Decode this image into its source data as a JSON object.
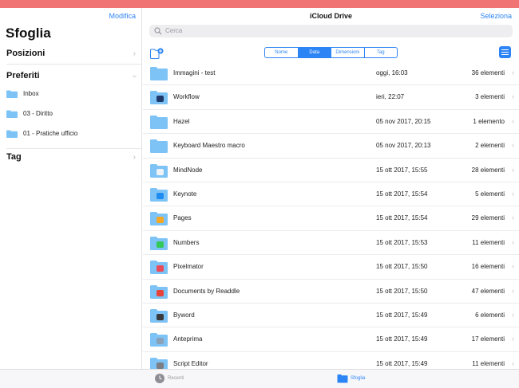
{
  "sidebar": {
    "edit_label": "Modifica",
    "title": "Sfoglia",
    "sections": {
      "locations": "Posizioni",
      "favorites": "Preferiti",
      "tags": "Tag"
    },
    "favorites": [
      {
        "label": "Inbox",
        "icon": "folder-icon"
      },
      {
        "label": "03 - Diritto",
        "icon": "folder-icon"
      },
      {
        "label": "01 - Pratiche ufficio",
        "icon": "folder-icon"
      }
    ]
  },
  "header": {
    "title": "iCloud Drive",
    "select_label": "Seleziona",
    "search_placeholder": "Cerca"
  },
  "sort": {
    "options": [
      "Nome",
      "Data",
      "Dimensioni",
      "Tag"
    ],
    "active": "Data"
  },
  "files": [
    {
      "name": "Immagini - test",
      "date": "oggi, 16:03",
      "count": "36 elementi",
      "badge": ""
    },
    {
      "name": "Workflow",
      "date": "ieri, 22:07",
      "count": "3 elementi",
      "badge": "#1f3a6a"
    },
    {
      "name": "Hazel",
      "date": "05 nov 2017, 20:15",
      "count": "1 elemento",
      "badge": ""
    },
    {
      "name": "Keyboard Maestro macro",
      "date": "05 nov 2017, 20:13",
      "count": "2 elementi",
      "badge": ""
    },
    {
      "name": "MindNode",
      "date": "15 ott 2017, 15:55",
      "count": "28 elementi",
      "badge": "#eef3f7"
    },
    {
      "name": "Keynote",
      "date": "15 ott 2017, 15:54",
      "count": "5 elementi",
      "badge": "#1e8bf0"
    },
    {
      "name": "Pages",
      "date": "15 ott 2017, 15:54",
      "count": "29 elementi",
      "badge": "#f5a623"
    },
    {
      "name": "Numbers",
      "date": "15 ott 2017, 15:53",
      "count": "11 elementi",
      "badge": "#34c759"
    },
    {
      "name": "Pixelmator",
      "date": "15 ott 2017, 15:50",
      "count": "16 elementi",
      "badge": "#e94b5a"
    },
    {
      "name": "Documents by Readdle",
      "date": "15 ott 2017, 15:50",
      "count": "47 elementi",
      "badge": "#e8433a"
    },
    {
      "name": "Byword",
      "date": "15 ott 2017, 15:49",
      "count": "6 elementi",
      "badge": "#3a3a3c"
    },
    {
      "name": "Anteprima",
      "date": "15 ott 2017, 15:49",
      "count": "17 elementi",
      "badge": "#8aa2b8"
    },
    {
      "name": "Script Editor",
      "date": "15 ott 2017, 15:49",
      "count": "11 elementi",
      "badge": "#7d7d84"
    }
  ],
  "tabbar": {
    "recenti": "Recenti",
    "sfoglia": "Sfoglia"
  },
  "colors": {
    "accent": "#2d84f5",
    "folder": "#7ec3f5",
    "status_bar": "#f07474"
  }
}
